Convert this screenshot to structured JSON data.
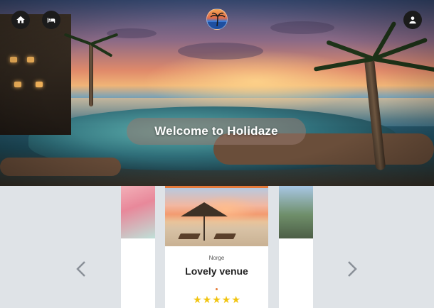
{
  "header": {
    "home_icon": "home-icon",
    "hotels_icon": "bed-icon",
    "profile_icon": "user-icon",
    "logo": "holidaze-logo"
  },
  "hero": {
    "welcome_text": "Welcome to Holidaze"
  },
  "carousel": {
    "prev_icon": "chevron-left-icon",
    "next_icon": "chevron-right-icon",
    "featured": {
      "country": "Norge",
      "title": "Lovely venue",
      "rating": 5,
      "stars": "★★★★★"
    }
  },
  "colors": {
    "accent": "#e67a3a",
    "star": "#f1c40f",
    "icon_bg": "#1b1b1b",
    "page_bg": "#dfe3e7"
  }
}
